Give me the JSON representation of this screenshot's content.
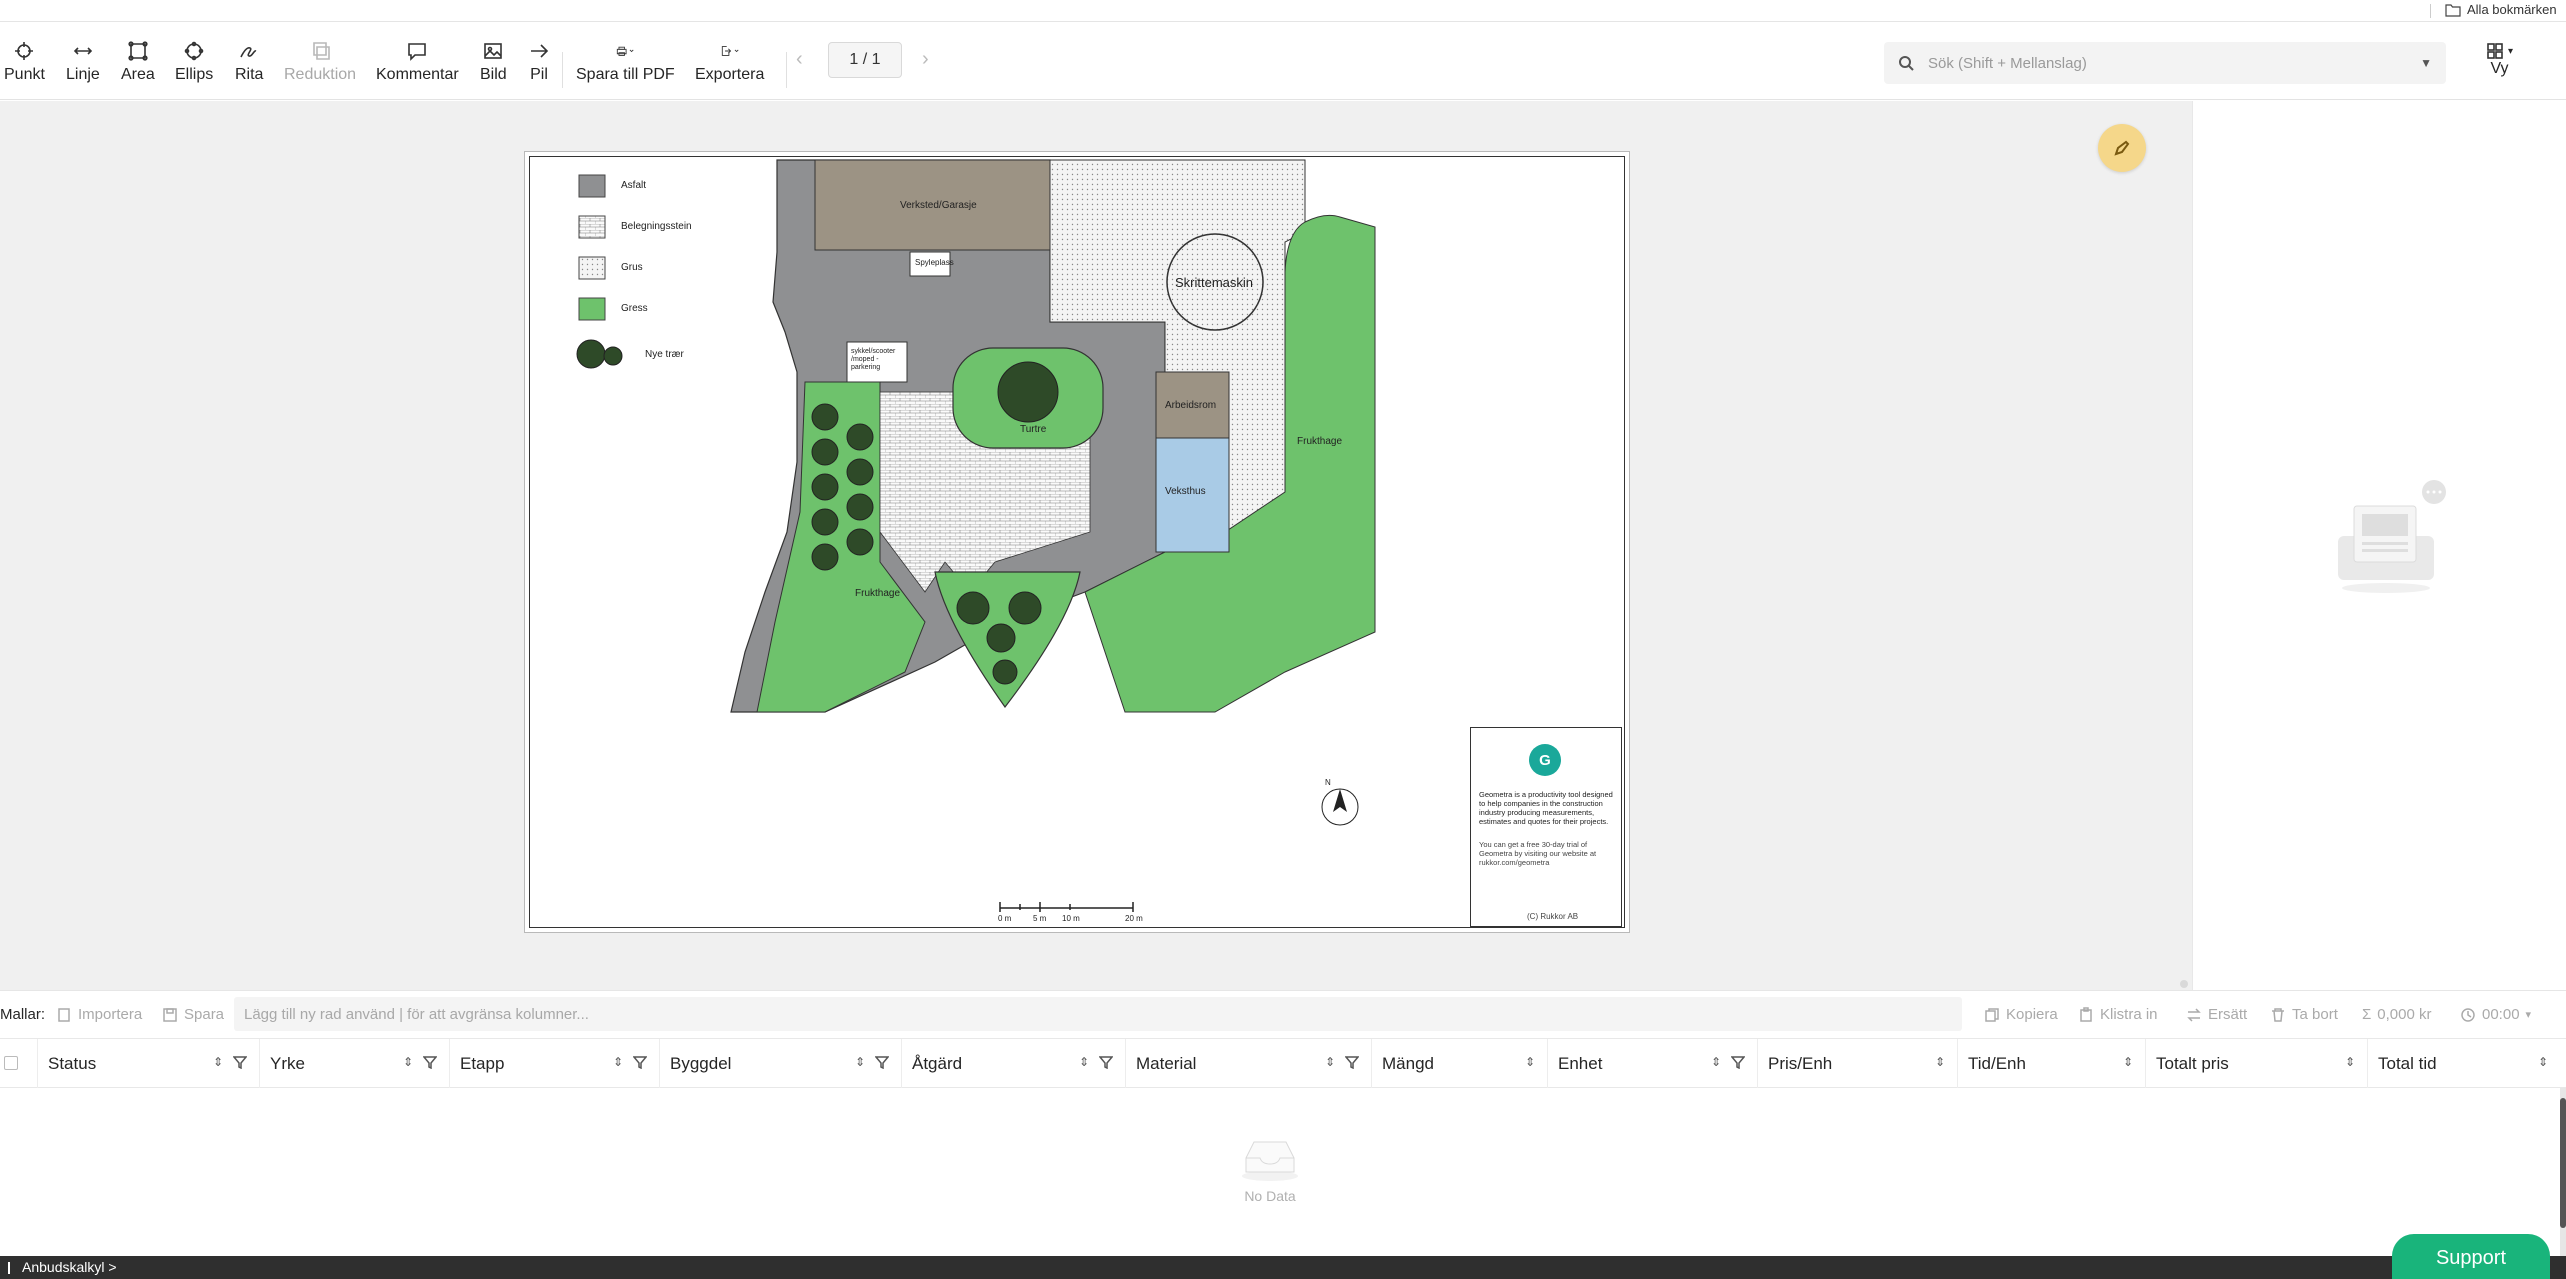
{
  "bookmarks": {
    "all_label": "Alla bokmärken"
  },
  "toolbar": {
    "tools": [
      {
        "label": "Punkt"
      },
      {
        "label": "Linje"
      },
      {
        "label": "Area"
      },
      {
        "label": "Ellips"
      },
      {
        "label": "Rita"
      },
      {
        "label": "Reduktion"
      },
      {
        "label": "Kommentar"
      },
      {
        "label": "Bild"
      },
      {
        "label": "Pil"
      },
      {
        "label": "Spara till PDF"
      },
      {
        "label": "Exportera"
      }
    ],
    "pager": "1 / 1",
    "search_placeholder": "Sök (Shift + Mellanslag)",
    "view_label": "Vy"
  },
  "plan": {
    "legend": [
      "Asfalt",
      "Belegningsstein",
      "Grus",
      "Gress",
      "Nye trær"
    ],
    "labels": {
      "verksted": "Verksted/Garasje",
      "spyleplass": "Spyleplass",
      "skrittemaskin": "Skrittemaskin",
      "sykkel": "sykkel/scooter /moped -parkering",
      "turtre": "Turtre",
      "arbeidsrom": "Arbeidsrom",
      "veksthus": "Veksthus",
      "frukthage_right": "Frukthage",
      "frukthage_left": "Frukthage"
    },
    "scale": [
      "0 m",
      "5 m",
      "10 m",
      "20 m"
    ],
    "north": "N",
    "titleblock": {
      "logo": "G",
      "text1": "Geometra is a productivity tool designed to help companies in the construction industry producing measurements, estimates and quotes for their projects.",
      "text2": "You can get a free 30-day trial of Geometra by visiting our website at rukkor.com/geometra",
      "copyright": "(C) Rukkor AB"
    }
  },
  "templates": {
    "label": "Mallar:",
    "import": "Importera",
    "save": "Spara",
    "input_placeholder": "Lägg till ny rad använd | för att avgränsa kolumner...",
    "copy": "Kopiera",
    "paste": "Klistra in",
    "replace": "Ersätt",
    "delete": "Ta bort",
    "total_price": "0,000 kr",
    "total_time": "00:00"
  },
  "table": {
    "columns": [
      "Status",
      "Yrke",
      "Etapp",
      "Byggdel",
      "Åtgärd",
      "Material",
      "Mängd",
      "Enhet",
      "Pris/Enh",
      "Tid/Enh",
      "Totalt pris",
      "Total tid"
    ],
    "empty_text": "No Data"
  },
  "footer": {
    "label": "Anbudskalkyl >"
  },
  "support": {
    "label": "Support"
  },
  "colors": {
    "asphalt": "#8f9092",
    "grass": "#6ec26c",
    "building": "#9c9384",
    "greenhouse": "#a9cbe6",
    "accent": "#19b47b",
    "fab": "#f5d78a"
  }
}
